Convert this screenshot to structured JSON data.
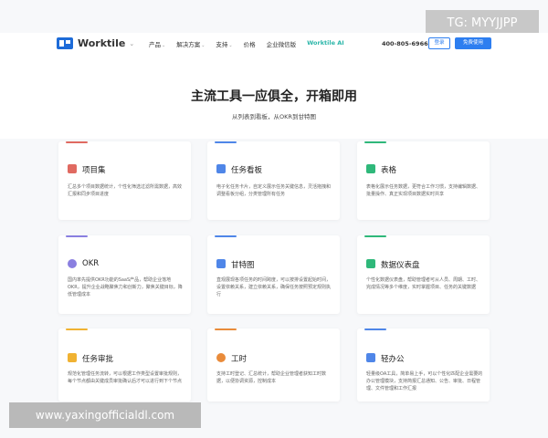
{
  "watermark_tag": "TG: MYYJJPP",
  "footer_watermark": "www.yaxingofficialdl.com",
  "header": {
    "brand": "Worktile",
    "brand_caret": "⌄",
    "nav": [
      {
        "label": "产品",
        "caret": "⌄"
      },
      {
        "label": "解决方案",
        "caret": "⌄"
      },
      {
        "label": "支持",
        "caret": "⌄"
      },
      {
        "label": "价格",
        "caret": ""
      },
      {
        "label": "企业微信版",
        "caret": ""
      },
      {
        "label": "Worktile AI",
        "caret": ""
      }
    ],
    "phone": "400-805-6966",
    "login_label": "登录",
    "free_label": "免费使用"
  },
  "hero": {
    "title": "主流工具一应俱全，开箱即用",
    "subtitle": "从列表到看板，从OKR到甘特图"
  },
  "colors": {
    "accent": "#2d7ef0",
    "ai": "#2bb6a9",
    "bars": [
      "#e06a61",
      "#4f86e8",
      "#2fb87a",
      "#8a7fe0",
      "#4f86e8",
      "#2fb87a",
      "#f0b232",
      "#e98b3a",
      "#4f86e8"
    ]
  },
  "features": [
    {
      "title": "项目集",
      "icon": "folder-icon",
      "desc": "汇总多个项目数据统计，个性化筛选过滤所需数据，高效汇报和同步项目进度"
    },
    {
      "title": "任务看板",
      "icon": "kanban-icon",
      "desc": "电子化任务卡片，自定义展示任务关键信息，灵活拖拽和调整看板分组，分类管理所有任务"
    },
    {
      "title": "表格",
      "icon": "table-icon",
      "desc": "表格化展示任务数据，更符合工作习惯，支持编辑数据、批量操作、真正实现项目数据实时共享"
    },
    {
      "title": "OKR",
      "icon": "target-icon",
      "desc": "国内率先提供OKR功能的SaaS产品，帮助企业落地OKR，提升企业战略聚焦力和创新力，聚焦关键目标，降低管理成本"
    },
    {
      "title": "甘特图",
      "icon": "gantt-icon",
      "desc": "直观展现各项任务的时间跨度，可以按排设置起始时间，设置依赖关系，建立依赖关系，确保任务按照预定规则执行"
    },
    {
      "title": "数据仪表盘",
      "icon": "chart-icon",
      "desc": "个性化数据仪表盘，帮助管理者可从人员、周期、工时、完成情况等多个维度，实时掌握项目、任务的关键数据"
    },
    {
      "title": "任务审批",
      "icon": "approval-icon",
      "desc": "规范化管理任务流转，可以根据工作类型设置审批规则，每个节点都由关键成员审批确认后才可以进行到下个节点"
    },
    {
      "title": "工时",
      "icon": "clock-icon",
      "desc": "支持工时登记、汇总统计，帮助企业管理者获知工时数据，以便协调资源，控制成本"
    },
    {
      "title": "轻办公",
      "icon": "office-icon",
      "desc": "轻量级OA工具，简单易上手，可以个性化匹配企业需要的办公管理模块，支持简报汇总通知、公告、审批、日程管理、文件管理和工作汇报"
    }
  ]
}
